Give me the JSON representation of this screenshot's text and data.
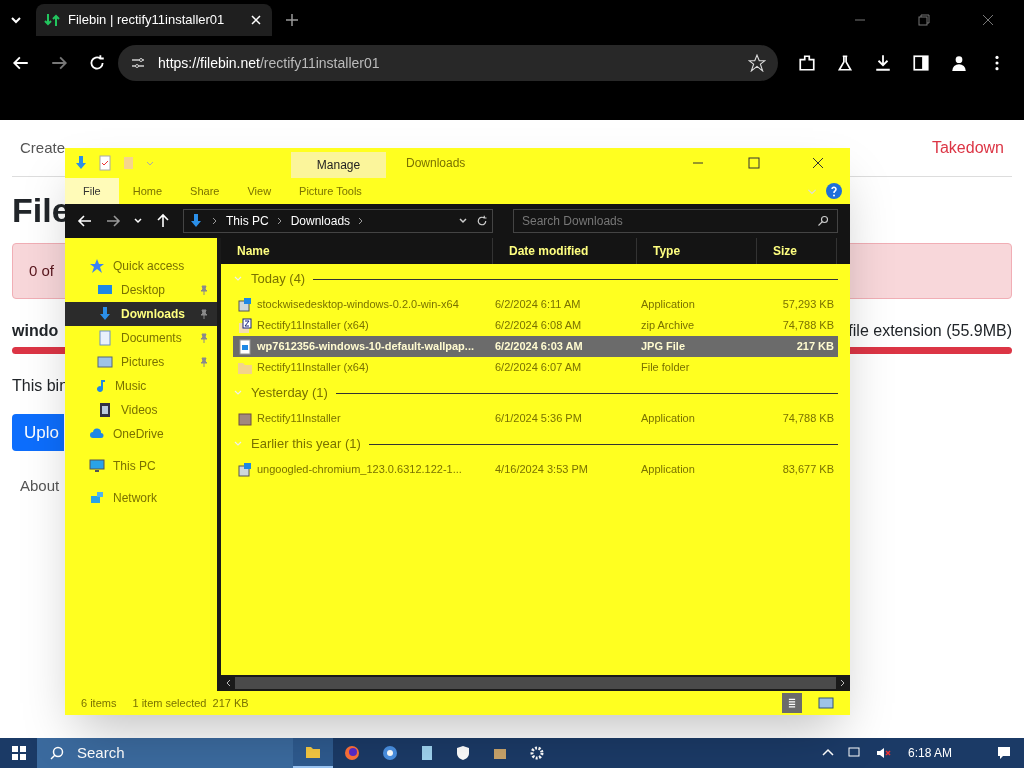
{
  "browser": {
    "tab_title": "Filebin | rectify11installer01",
    "url_host": "https://filebin.net",
    "url_path": "/rectify11installer01"
  },
  "page": {
    "create_link": "Create",
    "takedown_link": "Takedown",
    "heading": "File",
    "alert": "0 of ",
    "file_name": "windo",
    "file_meta": "file extension (55.9MB)",
    "note": "This bin",
    "upload_button": "Uplo",
    "about_link": "About"
  },
  "explorer": {
    "context_tab": "Manage",
    "title": "Downloads",
    "ribbon_tabs": [
      {
        "label": "File",
        "selected": true
      },
      {
        "label": "Home",
        "selected": false
      },
      {
        "label": "Share",
        "selected": false
      },
      {
        "label": "View",
        "selected": false
      },
      {
        "label": "Picture Tools",
        "selected": false
      }
    ],
    "breadcrumb": [
      "This PC",
      "Downloads"
    ],
    "search_placeholder": "Search Downloads",
    "columns": [
      "Name",
      "Date modified",
      "Type",
      "Size"
    ],
    "sidebar": [
      {
        "label": "Quick access",
        "kind": "star",
        "selected": false,
        "pinned": false,
        "children": [
          {
            "label": "Desktop",
            "kind": "desktop",
            "selected": false,
            "pinned": true
          },
          {
            "label": "Downloads",
            "kind": "download",
            "selected": true,
            "pinned": true
          },
          {
            "label": "Documents",
            "kind": "document",
            "selected": false,
            "pinned": true
          },
          {
            "label": "Pictures",
            "kind": "picture",
            "selected": false,
            "pinned": true
          },
          {
            "label": "Music",
            "kind": "music",
            "selected": false,
            "pinned": false
          },
          {
            "label": "Videos",
            "kind": "video",
            "selected": false,
            "pinned": false
          }
        ]
      },
      {
        "label": "OneDrive",
        "kind": "cloud",
        "selected": false,
        "pinned": false
      },
      {
        "label": "This PC",
        "kind": "pc",
        "selected": false,
        "pinned": false
      },
      {
        "label": "Network",
        "kind": "network",
        "selected": false,
        "pinned": false
      }
    ],
    "groups": [
      {
        "label": "Today (4)",
        "files": [
          {
            "name": "stockwisedesktop-windows-0.2.0-win-x64",
            "date": "6/2/2024 6:11 AM",
            "type": "Application",
            "size": "57,293 KB",
            "kind": "app",
            "selected": false
          },
          {
            "name": "Rectify11Installer (x64)",
            "date": "6/2/2024 6:08 AM",
            "type": "zip Archive",
            "size": "74,788 KB",
            "kind": "zip",
            "selected": false
          },
          {
            "name": "wp7612356-windows-10-default-wallpap...",
            "date": "6/2/2024 6:03 AM",
            "type": "JPG File",
            "size": "217 KB",
            "kind": "image",
            "selected": true
          },
          {
            "name": "Rectify11Installer (x64)",
            "date": "6/2/2024 6:07 AM",
            "type": "File folder",
            "kind": "folder",
            "selected": false
          }
        ]
      },
      {
        "label": "Yesterday (1)",
        "files": [
          {
            "name": "Rectify11Installer",
            "date": "6/1/2024 5:36 PM",
            "type": "Application",
            "size": "74,788 KB",
            "kind": "setup",
            "selected": false
          }
        ]
      },
      {
        "label": "Earlier this year (1)",
        "files": [
          {
            "name": "ungoogled-chromium_123.0.6312.122-1...",
            "date": "4/16/2024 3:53 PM",
            "type": "Application",
            "size": "83,677 KB",
            "kind": "app",
            "selected": false
          }
        ]
      }
    ],
    "status_items": "6 items",
    "status_selection": "1 item selected  217 KB"
  },
  "taskbar": {
    "search_placeholder": "Search",
    "time": "6:18 AM"
  }
}
